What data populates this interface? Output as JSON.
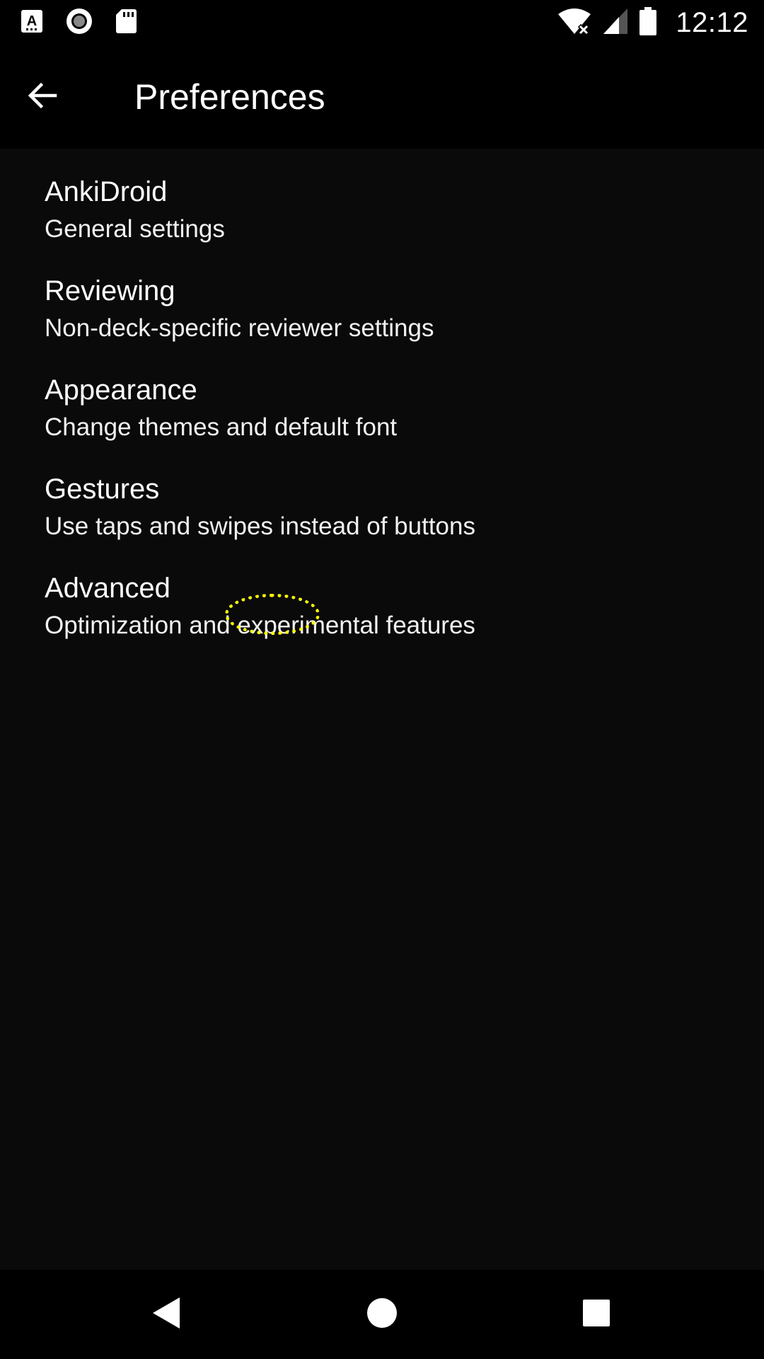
{
  "status_bar": {
    "time": "12:12",
    "left_icons": [
      "accessibility-a-icon",
      "record-icon",
      "sd-card-icon"
    ],
    "right_icons": [
      "wifi-no-internet-icon",
      "cell-signal-icon",
      "battery-icon"
    ]
  },
  "app_bar": {
    "title": "Preferences",
    "back_icon": "arrow-back-icon"
  },
  "preferences": [
    {
      "title": "AnkiDroid",
      "summary": "General settings"
    },
    {
      "title": "Reviewing",
      "summary": "Non-deck-specific reviewer settings"
    },
    {
      "title": "Appearance",
      "summary": "Change themes and default font"
    },
    {
      "title": "Gestures",
      "summary": "Use taps and swipes instead of buttons"
    },
    {
      "title": "Advanced",
      "summary": "Optimization and experimental features"
    }
  ],
  "nav_bar": {
    "icons": [
      "nav-back-icon",
      "nav-home-icon",
      "nav-recents-icon"
    ]
  },
  "colors": {
    "background": "#0a0a0a",
    "bars": "#000000",
    "text": "#ffffff",
    "tap_indicator": "#ffff00"
  }
}
